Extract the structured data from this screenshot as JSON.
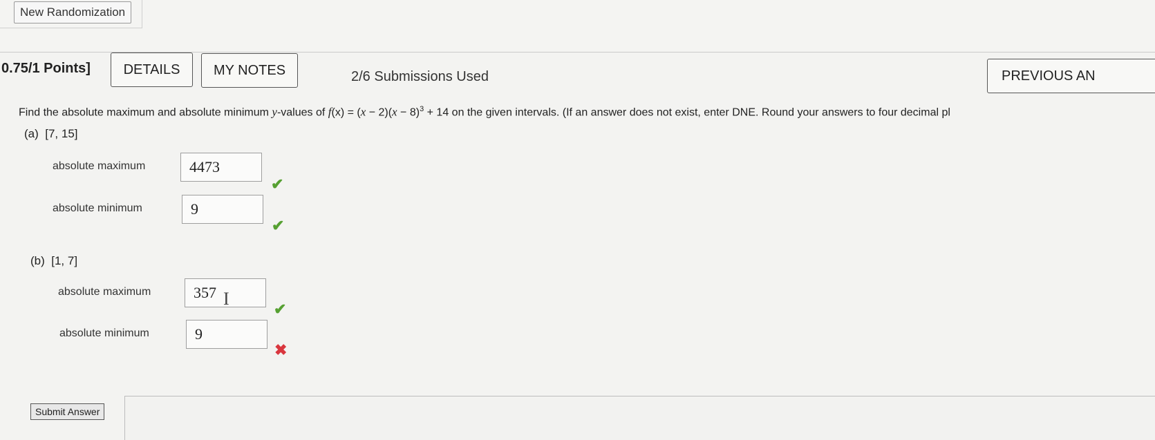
{
  "top": {
    "new_randomization": "New Randomization"
  },
  "header": {
    "points": "0.75/1 Points]",
    "details": "DETAILS",
    "my_notes": "MY NOTES",
    "submissions": "2/6 Submissions Used",
    "previous": "PREVIOUS AN"
  },
  "question": {
    "prefix": "Find the absolute maximum and absolute minimum ",
    "y": "y",
    "mid1": "-values of ",
    "fx": "f",
    "paren_x": "(x)",
    "eq": " = (",
    "x1": "x",
    "m1": " − 2)(",
    "x2": "x",
    "m2": " − 8)",
    "exp": "3",
    "suffix": " + 14 on the given intervals. (If an answer does not exist, enter DNE. Round your answers to four decimal pl"
  },
  "parts": [
    {
      "label": "(a)",
      "interval": "[7, 15]",
      "rows": [
        {
          "label": "absolute maximum",
          "value": "4473",
          "status": "correct",
          "mark": "✔"
        },
        {
          "label": "absolute minimum",
          "value": "9",
          "status": "correct",
          "mark": "✔"
        }
      ]
    },
    {
      "label": "(b)",
      "interval": "[1, 7]",
      "rows": [
        {
          "label": "absolute maximum",
          "value": "357",
          "status": "correct",
          "mark": "✔"
        },
        {
          "label": "absolute minimum",
          "value": "9",
          "status": "incorrect",
          "mark": "✖"
        }
      ]
    }
  ],
  "cursor": "I",
  "footer": {
    "submit": "Submit Answer"
  },
  "colors": {
    "correct": "#56a032",
    "incorrect": "#d9363e"
  }
}
